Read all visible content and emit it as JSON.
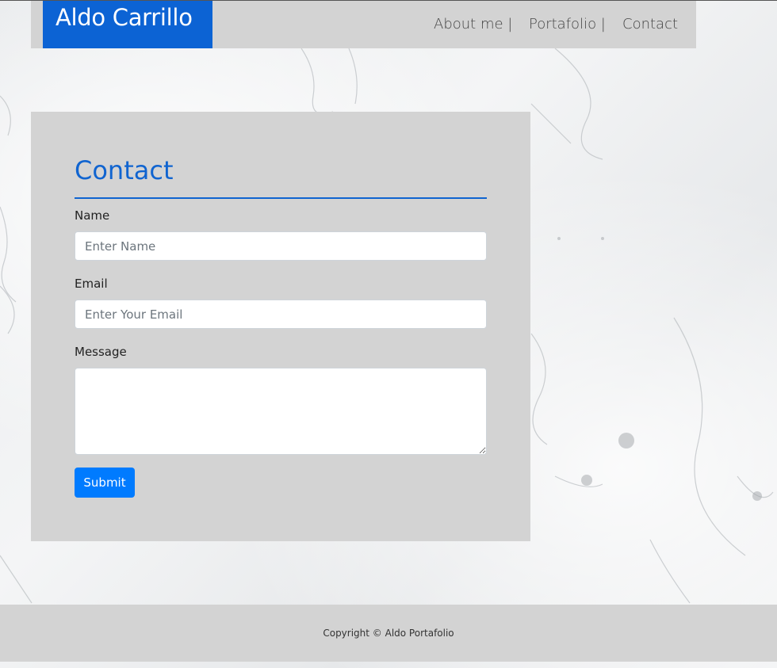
{
  "navbar": {
    "brand": "Aldo Carrillo",
    "links": [
      {
        "label": "About me |"
      },
      {
        "label": "Portafolio |"
      },
      {
        "label": "Contact"
      }
    ]
  },
  "contact_form": {
    "title": "Contact",
    "name_label": "Name",
    "name_placeholder": "Enter Name",
    "email_label": "Email",
    "email_placeholder": "Enter Your Email",
    "message_label": "Message",
    "submit_label": "Submit"
  },
  "footer": {
    "copyright": "Copyright © Aldo Portafolio"
  },
  "colors": {
    "brand_blue": "#0c63d4",
    "panel_gray": "#d3d3d3",
    "button_blue": "#007bff"
  }
}
